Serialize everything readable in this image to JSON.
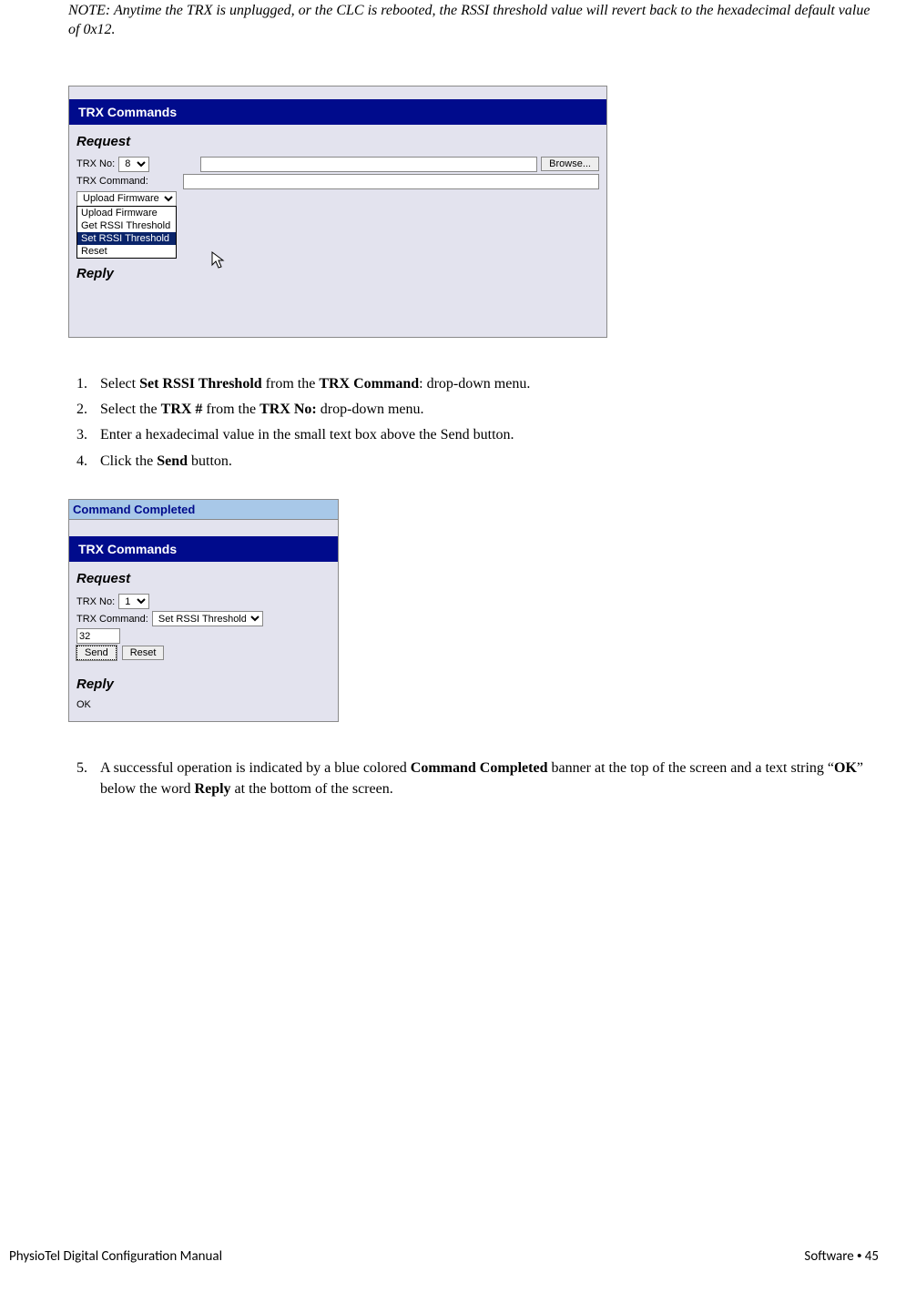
{
  "note": "NOTE:  Anytime the TRX is unplugged, or the CLC is rebooted, the RSSI threshold value will revert back to the hexadecimal default value of 0x12.",
  "shot1": {
    "title": "TRX Commands",
    "request_label": "Request",
    "trx_no_label": "TRX No:",
    "trx_no_value": "8",
    "trx_command_label": "TRX Command:",
    "browse_label": "Browse...",
    "selected_combo": "Upload Firmware",
    "options": [
      "Upload Firmware",
      "Get RSSI Threshold",
      "Set RSSI Threshold",
      "Reset"
    ],
    "highlighted_option": "Set RSSI Threshold",
    "reply_label": "Reply"
  },
  "steps_a": {
    "s1_pre": "Select ",
    "s1_b1": "Set RSSI Threshold",
    "s1_mid": " from the ",
    "s1_b2": "TRX Command",
    "s1_post": ": drop-down menu.",
    "s2_pre": "Select the ",
    "s2_b1": "TRX #",
    "s2_mid": " from the ",
    "s2_b2": "TRX No:",
    "s2_post": " drop-down menu.",
    "s3": "Enter a hexadecimal value in the small text box above the Send button.",
    "s4_pre": "Click the ",
    "s4_b": "Send",
    "s4_post": " button."
  },
  "shot2": {
    "banner": "Command Completed",
    "title": "TRX Commands",
    "request_label": "Request",
    "trx_no_label": "TRX No:",
    "trx_no_value": "1",
    "trx_command_label": "TRX Command:",
    "trx_command_value": "Set RSSI Threshold",
    "hex_value": "32",
    "send_label": "Send",
    "reset_label": "Reset",
    "reply_label": "Reply",
    "reply_text": "OK"
  },
  "steps_b": {
    "s5_pre": "A successful operation is indicated by a blue colored ",
    "s5_b1": "Command Completed",
    "s5_mid1": " banner at the top of the screen and a text string “",
    "s5_b2": "OK",
    "s5_mid2": "” below the word ",
    "s5_b3": "Reply",
    "s5_post": " at the bottom of the screen."
  },
  "footer": {
    "left": "PhysioTel Digital Configuration Manual",
    "right_section": "Software",
    "right_page": "45"
  }
}
